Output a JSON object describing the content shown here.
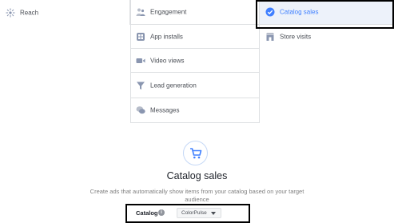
{
  "objectives": {
    "col1": [
      {
        "label": "Reach",
        "icon": "reach-icon"
      }
    ],
    "col2": [
      {
        "label": "Engagement",
        "icon": "engagement-icon"
      },
      {
        "label": "App installs",
        "icon": "app-installs-icon"
      },
      {
        "label": "Video views",
        "icon": "video-camera-icon"
      },
      {
        "label": "Lead generation",
        "icon": "funnel-icon"
      },
      {
        "label": "Messages",
        "icon": "chat-bubbles-icon"
      }
    ],
    "col3": [
      {
        "label": "Catalog sales",
        "icon": "check-circle-icon",
        "selected": true
      },
      {
        "label": "Store visits",
        "icon": "store-icon"
      }
    ]
  },
  "detail": {
    "icon": "shopping-cart-icon",
    "title": "Catalog sales",
    "description": "Create ads that automatically show items from your catalog based on your target audience",
    "catalog_label": "Catalog",
    "catalog_value": "ColorPulse"
  },
  "colors": {
    "accent": "#4080ff",
    "selected_bg": "#edf2fa",
    "border": "#dddfe2",
    "highlight_box": "#000000"
  }
}
